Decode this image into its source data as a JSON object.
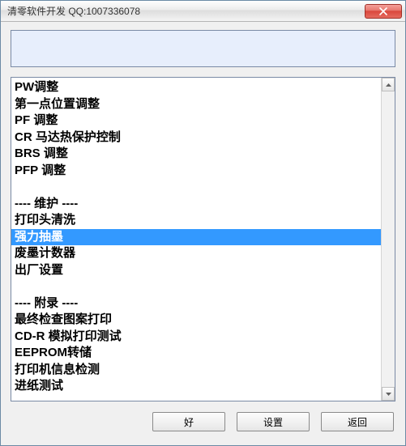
{
  "window": {
    "title": "清零软件开发 QQ:1007336078"
  },
  "list": {
    "items": [
      "PW调整",
      "第一点位置调整",
      "PF 调整",
      "CR 马达热保护控制",
      "BRS 调整",
      "PFP 调整",
      "",
      "---- 维护 ----",
      "打印头清洗",
      "强力抽墨",
      "废墨计数器",
      "出厂设置",
      "",
      "---- 附录 ----",
      "最终检查图案打印",
      "CD-R 模拟打印测试",
      "EEPROM转储",
      "打印机信息检测",
      "进纸测试"
    ],
    "selected_index": 9
  },
  "buttons": {
    "ok": "好",
    "settings": "设置",
    "back": "返回"
  }
}
